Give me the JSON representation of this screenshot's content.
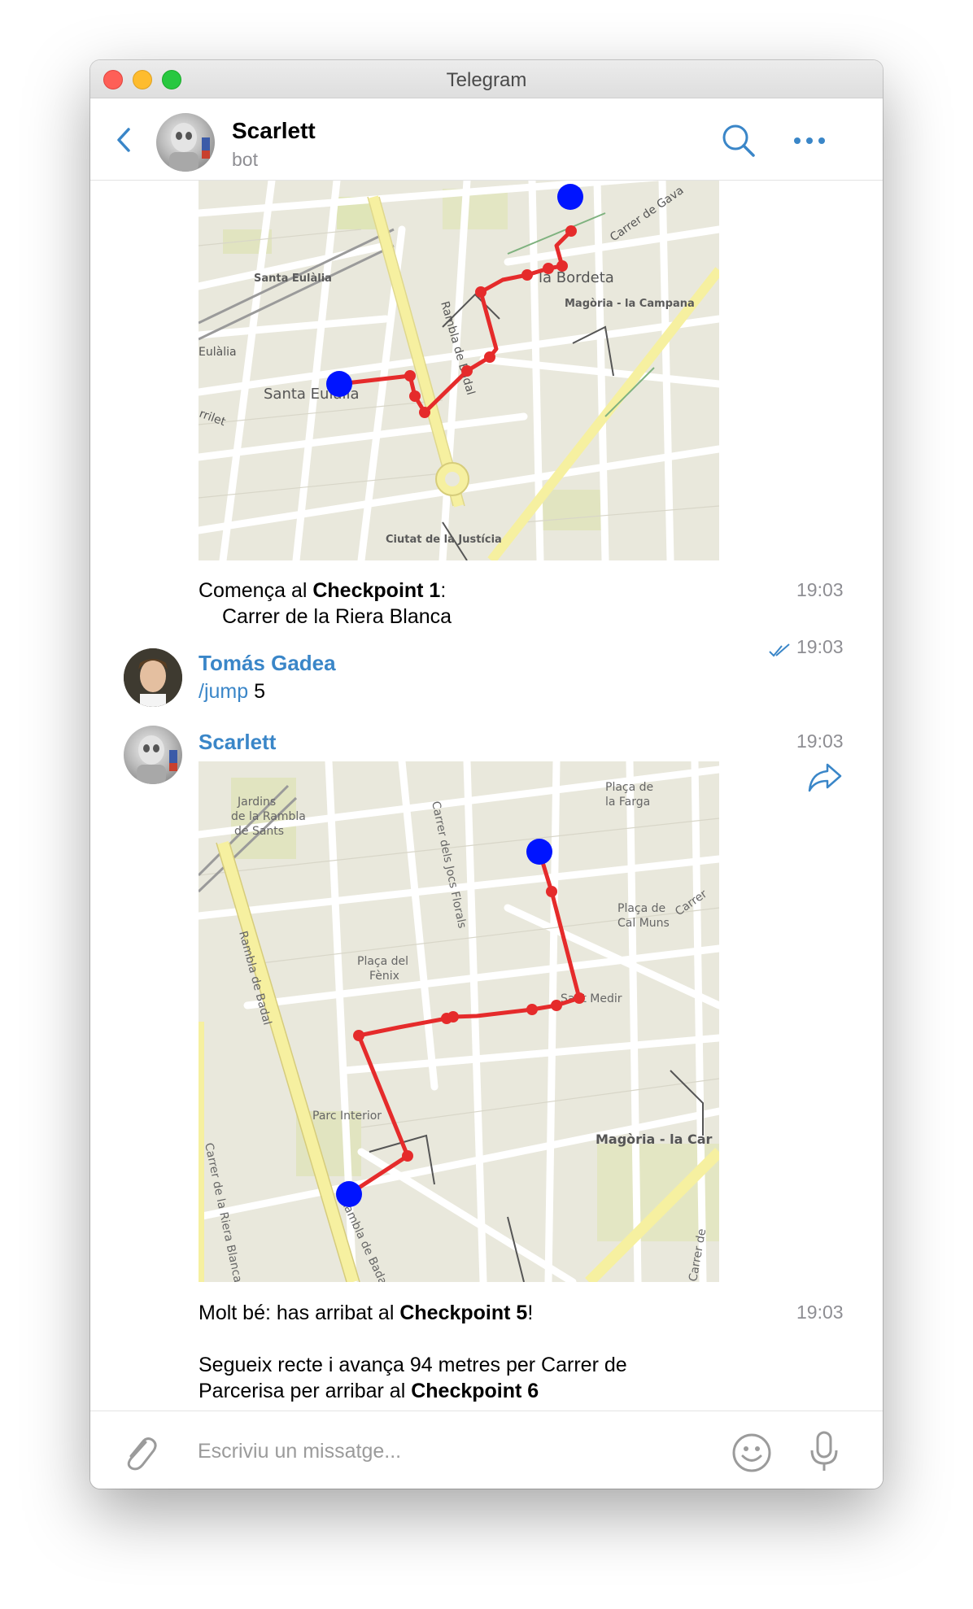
{
  "window": {
    "title": "Telegram"
  },
  "header": {
    "name": "Scarlett",
    "status": "bot"
  },
  "messages": {
    "m1": {
      "line1_prefix": "Comença al ",
      "line1_bold": "Checkpoint 1",
      "line1_suffix": ":",
      "line2": "Carrer de la Riera Blanca",
      "time": "19:03"
    },
    "m2": {
      "sender": "Tomás Gadea",
      "command": "/jump",
      "arg": " 5",
      "time": "19:03"
    },
    "m3": {
      "sender": "Scarlett",
      "time": "19:03",
      "text1_prefix": "Molt bé: has arribat al ",
      "text1_bold": "Checkpoint 5",
      "text1_suffix": "!",
      "time2": "19:03",
      "text2_line1": "Segueix recte i avança 94 metres per Carrer de",
      "text2_line2_prefix": "Parcerisa per arribar al ",
      "text2_line2_bold": "Checkpoint 6"
    }
  },
  "maps": {
    "map1": {
      "labels": [
        "Santa Eulàlia",
        "Santa Eulàlia",
        "Eulàlia",
        "la Bordeta",
        "Magòria - la Campana",
        "Rambla de Badal",
        "Carrer de Gava",
        "Ciutat de la Justícia",
        "rrilet"
      ]
    },
    "map2": {
      "labels": [
        "Jardins",
        "de la Rambla",
        "de Sants",
        "Carrer dels Jocs Florals",
        "Plaça de",
        "la Farga",
        "Plaça de",
        "Cal Muns",
        "Carrer",
        "Plaça del",
        "Fènix",
        "Rambla de Badal",
        "Sant Medir",
        "Parc Interior",
        "Magòria - la Car",
        "Carrer de la Riera Blanca",
        "Rambla de Badal",
        "Carrer de"
      ]
    }
  },
  "composer": {
    "placeholder": "Escriviu un missatge..."
  },
  "colors": {
    "accent": "#3a86c8",
    "route": "#e52b2b",
    "checkpoint": "#0014ff",
    "meta": "#8e8e93"
  },
  "icons": [
    "back-chevron-icon",
    "search-icon",
    "more-dots-icon",
    "forward-share-icon",
    "double-check-icon",
    "paperclip-icon",
    "emoji-icon",
    "microphone-icon"
  ]
}
